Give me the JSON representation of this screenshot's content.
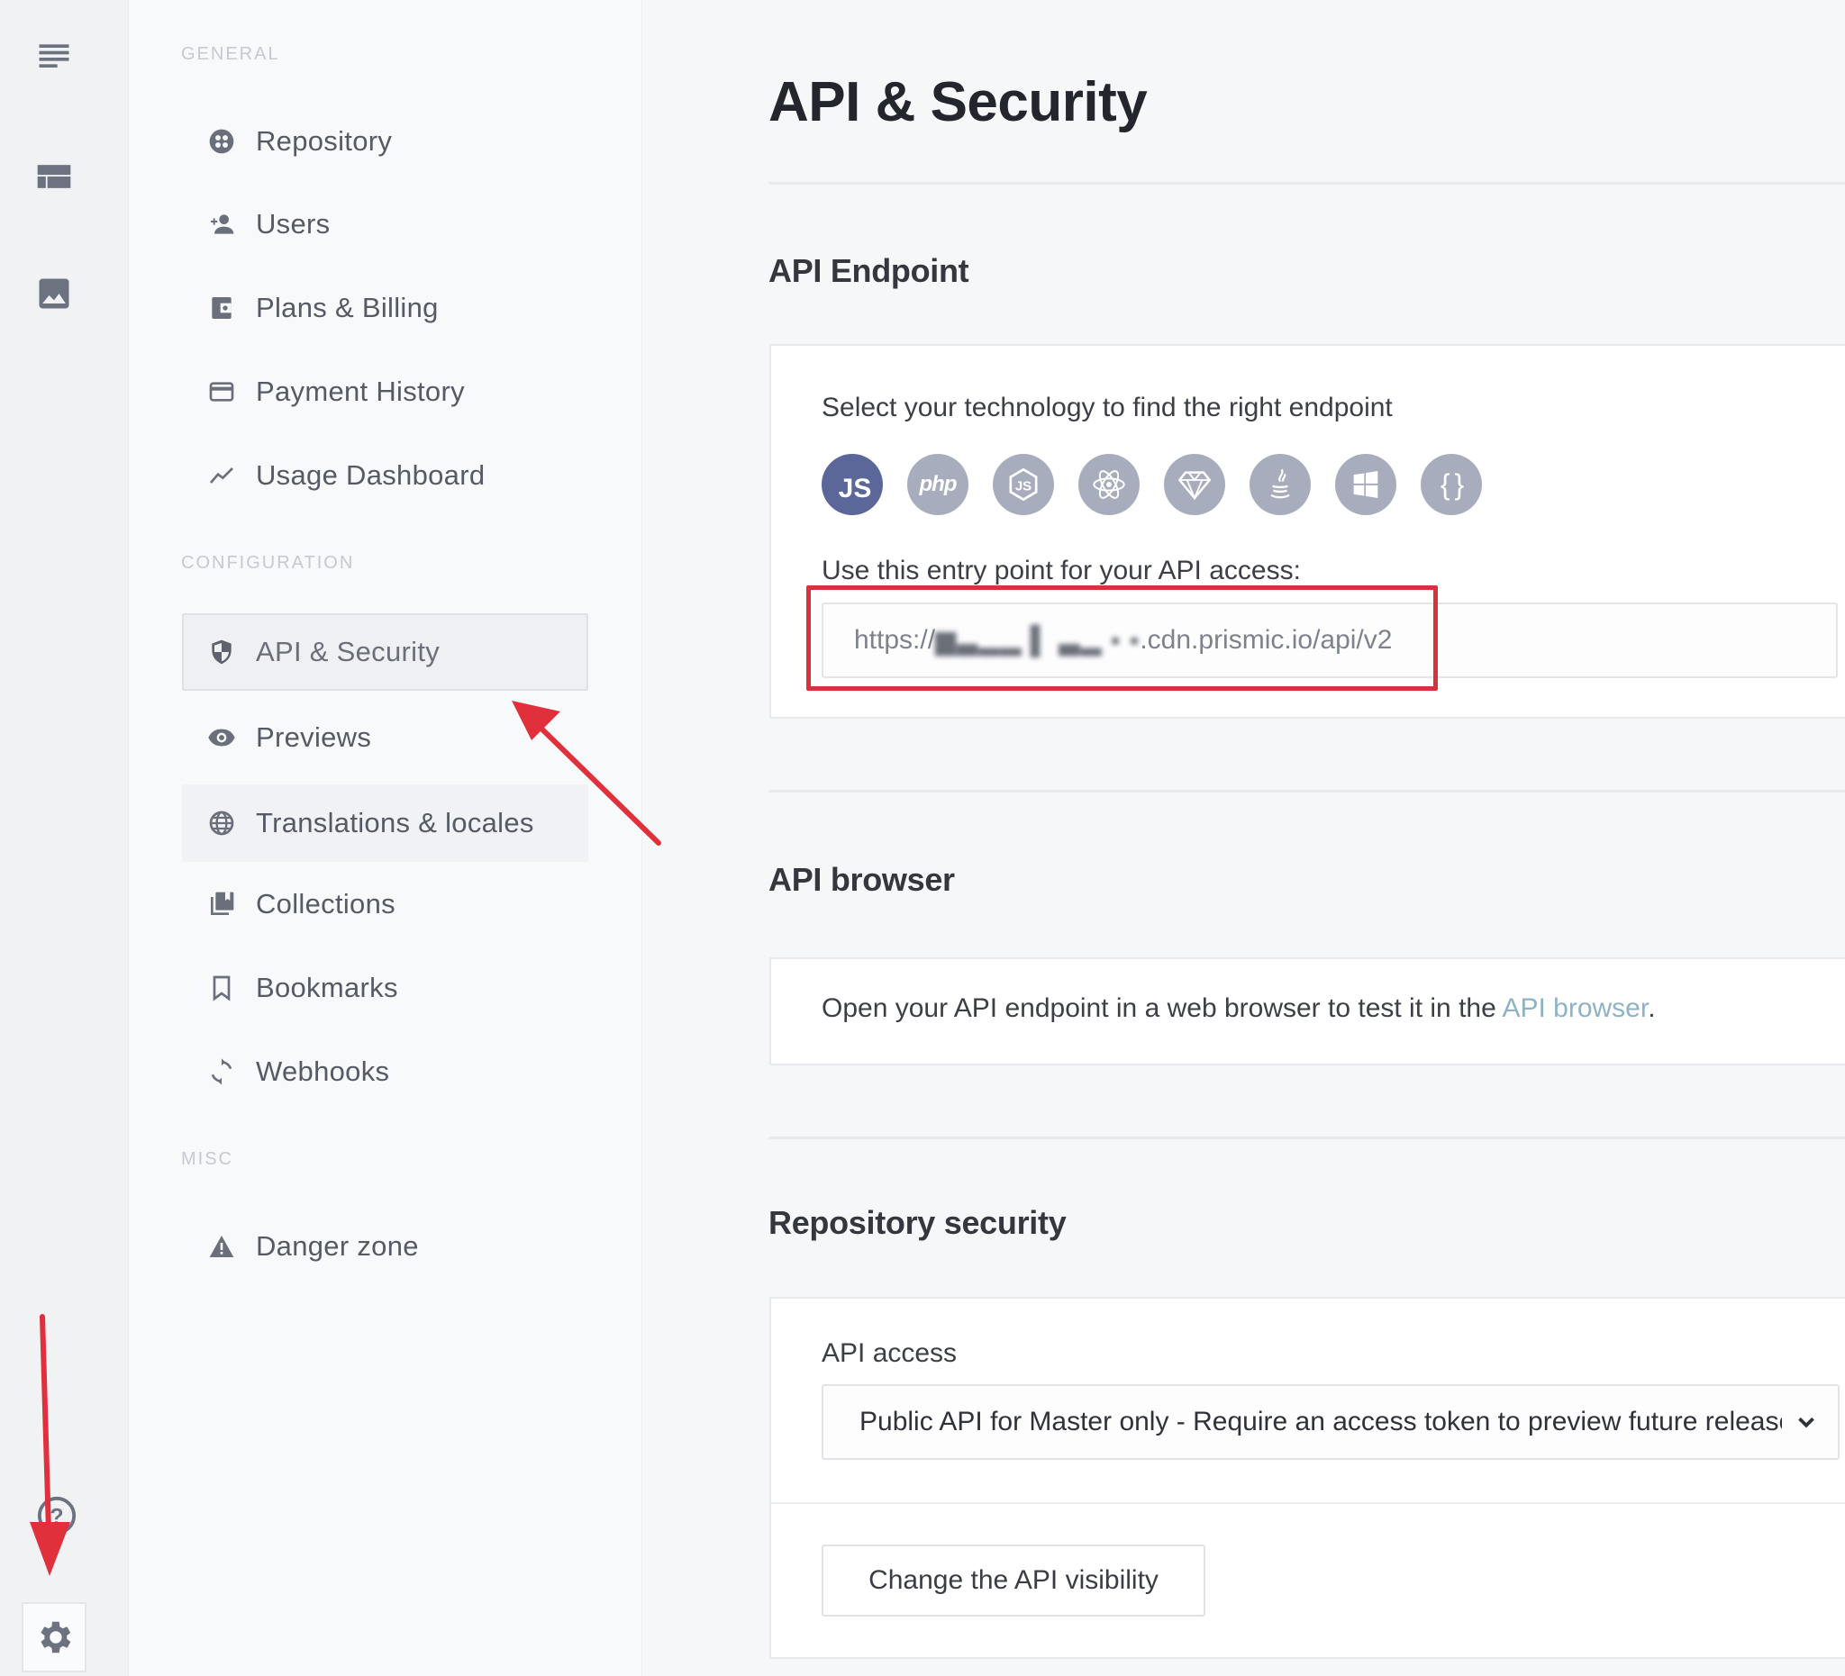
{
  "rail": {
    "icons": [
      {
        "name": "documents-icon",
        "label": "Documents"
      },
      {
        "name": "custom-types-icon",
        "label": "Custom types"
      },
      {
        "name": "media-library-icon",
        "label": "Media library"
      }
    ],
    "help_icon": "help-icon",
    "settings_icon": "gear-icon"
  },
  "sidebar": {
    "sections": [
      {
        "header": "GENERAL",
        "items": [
          {
            "label": "Repository",
            "icon": "repository-icon"
          },
          {
            "label": "Users",
            "icon": "add-user-icon"
          },
          {
            "label": "Plans & Billing",
            "icon": "wallet-icon"
          },
          {
            "label": "Payment History",
            "icon": "credit-card-icon"
          },
          {
            "label": "Usage Dashboard",
            "icon": "trend-icon"
          }
        ]
      },
      {
        "header": "CONFIGURATION",
        "items": [
          {
            "label": "API & Security",
            "icon": "shield-icon",
            "active": true
          },
          {
            "label": "Previews",
            "icon": "eye-icon"
          },
          {
            "label": "Translations & locales",
            "icon": "globe-icon"
          },
          {
            "label": "Collections",
            "icon": "collections-icon"
          },
          {
            "label": "Bookmarks",
            "icon": "bookmark-icon"
          },
          {
            "label": "Webhooks",
            "icon": "refresh-icon"
          }
        ]
      },
      {
        "header": "MISC",
        "items": [
          {
            "label": "Danger zone",
            "icon": "warning-icon"
          }
        ]
      }
    ]
  },
  "main": {
    "title": "API & Security",
    "endpoint": {
      "heading": "API Endpoint",
      "select_label": "Select your technology to find the right endpoint",
      "technologies": [
        {
          "name": "JavaScript",
          "glyph": "JS",
          "selected": true
        },
        {
          "name": "PHP",
          "glyph": "php"
        },
        {
          "name": "Node.js",
          "glyph": "node"
        },
        {
          "name": "React",
          "glyph": "react"
        },
        {
          "name": "Ruby",
          "glyph": "ruby"
        },
        {
          "name": "Java",
          "glyph": "java"
        },
        {
          "name": ".NET",
          "glyph": "windows"
        },
        {
          "name": "Other",
          "glyph": "{ }"
        }
      ],
      "entry_label": "Use this entry point for your API access:",
      "url_prefix": "https://",
      "url_redacted": "▆▃▂▂ ▌ ▃▂ ▪ ▪",
      "url_suffix": ".cdn.prismic.io/api/v2"
    },
    "browser": {
      "heading": "API browser",
      "text": "Open your API endpoint in a web browser to test it in the ",
      "link": "API browser",
      "text_end": "."
    },
    "security": {
      "heading": "Repository security",
      "access_label": "API access",
      "access_value": "Public API for Master only - Require an access token to preview future releases",
      "button": "Change the API visibility"
    }
  },
  "annotations": {
    "color": "#d9323f"
  }
}
